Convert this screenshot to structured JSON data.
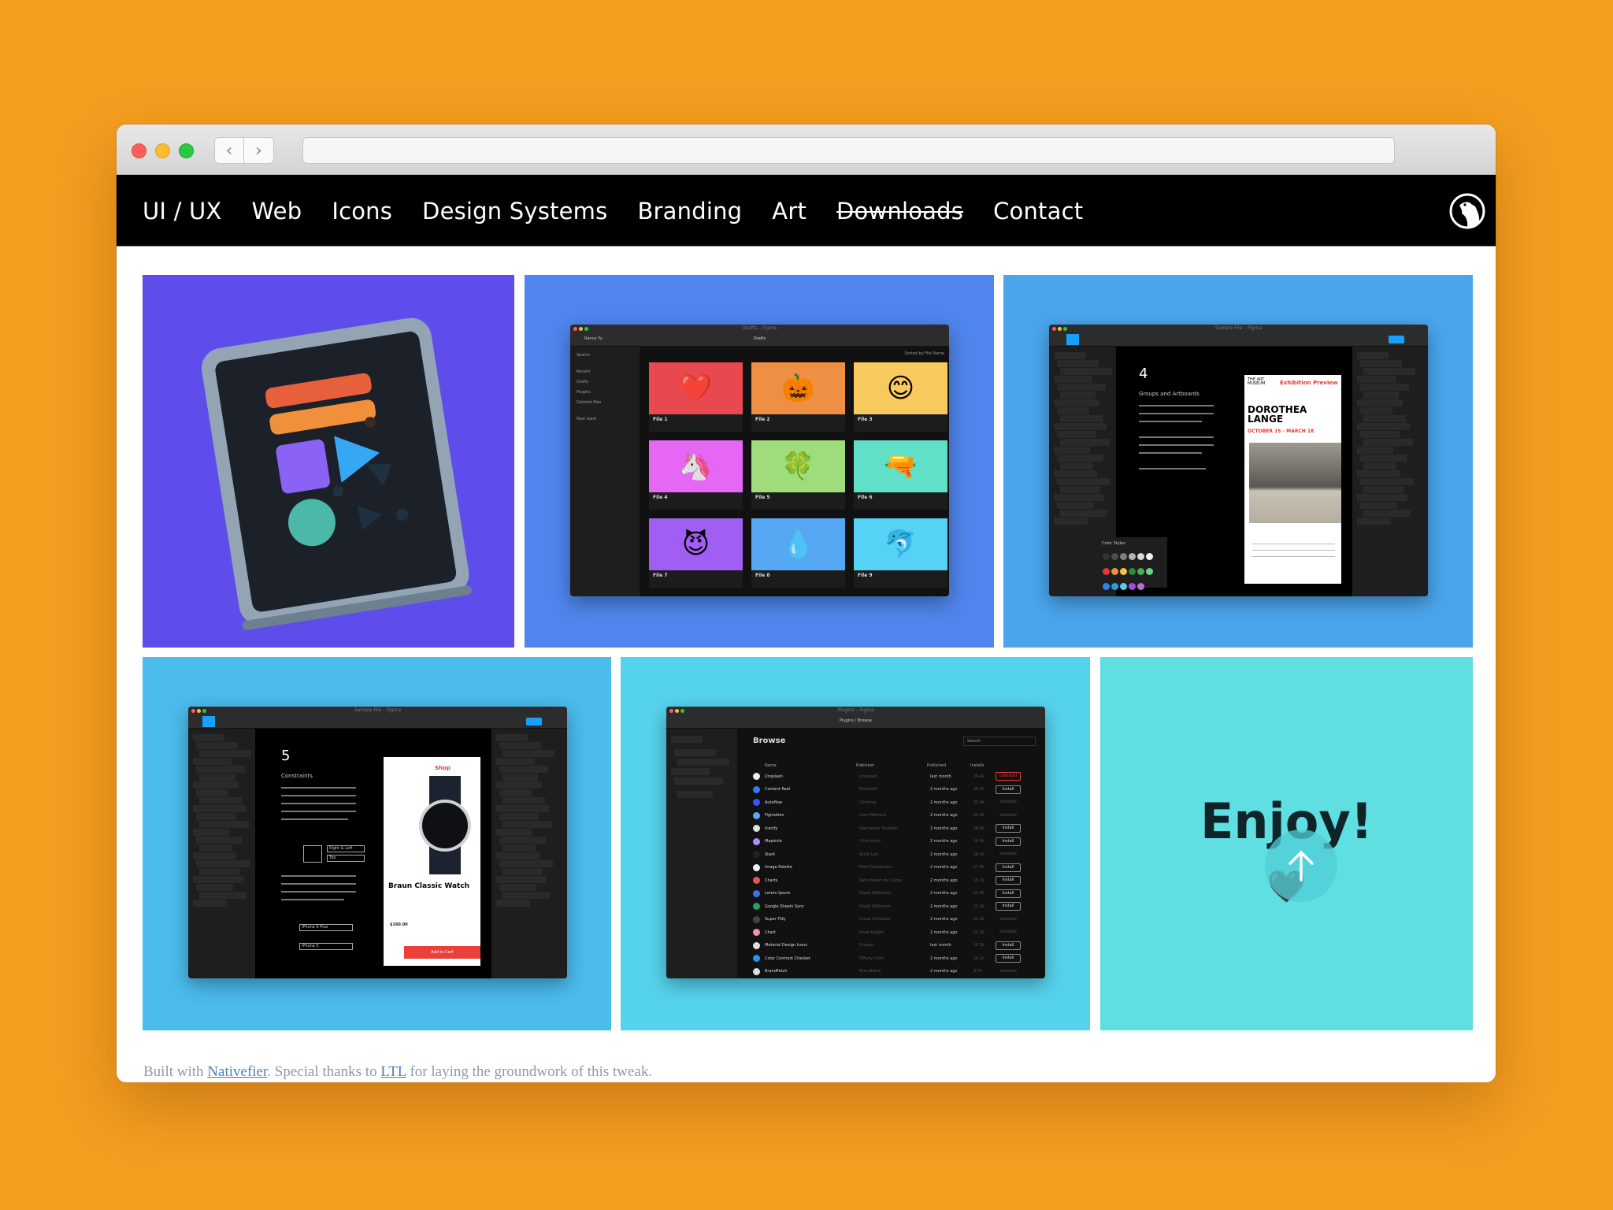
{
  "browser": {
    "back_label": "‹",
    "forward_label": "›",
    "address_value": ""
  },
  "nav": {
    "items": [
      {
        "label": "UI / UX",
        "strikethrough": false
      },
      {
        "label": "Web",
        "strikethrough": false
      },
      {
        "label": "Icons",
        "strikethrough": false
      },
      {
        "label": "Design Systems",
        "strikethrough": false
      },
      {
        "label": "Branding",
        "strikethrough": false
      },
      {
        "label": "Art",
        "strikethrough": false
      },
      {
        "label": "Downloads",
        "strikethrough": true
      },
      {
        "label": "Contact",
        "strikethrough": false
      }
    ],
    "logo_icon": "bird-circle-logo-icon"
  },
  "tiles": [
    {
      "name": "figma-app-icon",
      "bg": "#5e4deb"
    },
    {
      "name": "figma-drafts-screenshot",
      "bg": "#4f85ec",
      "window_title": "Drafts – Figma",
      "header": "Drafts",
      "user": "Rance Yu",
      "sidebar": [
        "Search",
        "Recent",
        "Drafts",
        "Plugins",
        "Deleted files",
        "New team"
      ],
      "sort_label": "Sorted by File Name",
      "files": [
        {
          "label": "File 1",
          "emoji": "❤️",
          "color": "#e8494e"
        },
        {
          "label": "File 2",
          "emoji": "🎃",
          "color": "#ef8f43"
        },
        {
          "label": "File 3",
          "emoji": "😊",
          "color": "#f8c95c"
        },
        {
          "label": "File 4",
          "emoji": "🦄",
          "color": "#e567f3"
        },
        {
          "label": "File 5",
          "emoji": "🍀",
          "color": "#9fdc7c"
        },
        {
          "label": "File 6",
          "emoji": "🔫",
          "color": "#60e0c6"
        },
        {
          "label": "File 7",
          "emoji": "😈",
          "color": "#a05ef3"
        },
        {
          "label": "File 8",
          "emoji": "💧",
          "color": "#57a8f4"
        },
        {
          "label": "File 9",
          "emoji": "🐬",
          "color": "#55d2f6"
        }
      ]
    },
    {
      "name": "figma-groups-artboards-screenshot",
      "bg": "#4aa5ec",
      "window_title": "Sample File – Figma",
      "step_number": "4",
      "step_title": "Groups and Artboards",
      "phone_brand": "THE ART MUSEUM",
      "phone_title": "Exhibition Preview",
      "artist": "DOROTHEA LANGE",
      "dates": "OCTOBER 15 - MARCH 18",
      "panel_title": "Color Styles",
      "swatches": [
        "#333333",
        "#4d4d4d",
        "#808080",
        "#b3b3b3",
        "#d9d9d9",
        "#f2f2f2",
        "#e53935",
        "#ef8f43",
        "#f4c542",
        "#2e8b3d",
        "#4caf50",
        "#6fd08c",
        "#2f80ed",
        "#2d9cdb",
        "#56ccf2",
        "#9b51e0",
        "#bb6bd9"
      ]
    },
    {
      "name": "figma-constraints-screenshot",
      "bg": "#4bbcec",
      "window_title": "Sample File – Figma",
      "step_number": "5",
      "step_title": "Constraints",
      "phone_title": "Shop",
      "product": "Braun Classic Watch",
      "price": "$160.00",
      "cta": "Add to Cart",
      "dropdown_1": "Right & Left",
      "dropdown_2": "Top",
      "device_1": "iPhone 6 Plus",
      "device_2": "iPhone 5"
    },
    {
      "name": "figma-plugins-browse-screenshot",
      "bg": "#56d3ec",
      "window_title": "Plugins – Figma",
      "breadcrumb": "Plugins / Browse",
      "heading": "Browse",
      "search_placeholder": "Search",
      "columns": [
        "Name",
        "Publisher",
        "Published",
        "Installs"
      ],
      "plugins": [
        {
          "name": "Unsplash",
          "publisher": "Unsplash",
          "published": "last month",
          "installs": "29.4k",
          "action": "Uninstall",
          "state": "un",
          "color": "#eeeeee"
        },
        {
          "name": "Content Reel",
          "publisher": "Microsoft",
          "published": "2 months ago",
          "installs": "29.5k",
          "action": "Install",
          "state": "in",
          "color": "#2d7ff9"
        },
        {
          "name": "Autoflow",
          "publisher": "Comtrue",
          "published": "2 months ago",
          "installs": "25.4k",
          "action": "Installed",
          "state": "done",
          "color": "#3355ff"
        },
        {
          "name": "Figmotion",
          "publisher": "Liam Martens",
          "published": "2 months ago",
          "installs": "24.5k",
          "action": "Installed",
          "state": "done",
          "color": "#55aaff"
        },
        {
          "name": "Iconify",
          "publisher": "Vjacheslav Trushkin",
          "published": "2 months ago",
          "installs": "18.0k",
          "action": "Install",
          "state": "in",
          "color": "#dddddd"
        },
        {
          "name": "Mapsicle",
          "publisher": "Chris Anon",
          "published": "2 months ago",
          "installs": "18.4k",
          "action": "Install",
          "state": "in",
          "color": "#b388ff"
        },
        {
          "name": "Stark",
          "publisher": "Stark Lab",
          "published": "2 months ago",
          "installs": "18.3k",
          "action": "Installed",
          "state": "done",
          "color": "#222222"
        },
        {
          "name": "Image Palette",
          "publisher": "Matt DesLauriers",
          "published": "2 months ago",
          "installs": "17.6k",
          "action": "Install",
          "state": "in",
          "color": "#f2f2f2"
        },
        {
          "name": "Charts",
          "publisher": "Sam Mason de Caires",
          "published": "2 months ago",
          "installs": "15.7k",
          "action": "Install",
          "state": "in",
          "color": "#e0574f"
        },
        {
          "name": "Lorem Ipsum",
          "publisher": "David Williames",
          "published": "2 months ago",
          "installs": "13.5k",
          "action": "Install",
          "state": "in",
          "color": "#3d6df2"
        },
        {
          "name": "Google Sheets Sync",
          "publisher": "David Williames",
          "published": "2 months ago",
          "installs": "11.2k",
          "action": "Install",
          "state": "in",
          "color": "#1fa463"
        },
        {
          "name": "Super Tidy",
          "publisher": "Ismail Gonzalez",
          "published": "2 months ago",
          "installs": "11.2k",
          "action": "Installed",
          "state": "done",
          "color": "#444444"
        },
        {
          "name": "Chart",
          "publisher": "Pavel Kuligin",
          "published": "2 months ago",
          "installs": "11.2k",
          "action": "Installed",
          "state": "done",
          "color": "#f48fb1"
        },
        {
          "name": "Material Design Icons",
          "publisher": "Oraqoo",
          "published": "last month",
          "installs": "10.3k",
          "action": "Install",
          "state": "in",
          "color": "#e0e0e0"
        },
        {
          "name": "Color Contrast Checker",
          "publisher": "Tiffany Chen",
          "published": "2 months ago",
          "installs": "10.1k",
          "action": "Install",
          "state": "in",
          "color": "#2196f3"
        },
        {
          "name": "BrandFetch",
          "publisher": "Brandfetch",
          "published": "2 months ago",
          "installs": "9.7k",
          "action": "Installed",
          "state": "done",
          "color": "#dddddd"
        }
      ]
    },
    {
      "name": "enjoy-tile",
      "bg": "#60dfe3",
      "text": "Enjoy!",
      "emoji": "🖤"
    }
  ],
  "scroll_top_icon": "arrow-up-icon",
  "footer": {
    "prefix": "Built with ",
    "link1": "Nativefier",
    "middle": ". Special thanks to ",
    "link2": "LTL",
    "suffix": " for laying the groundwork of this tweak."
  }
}
